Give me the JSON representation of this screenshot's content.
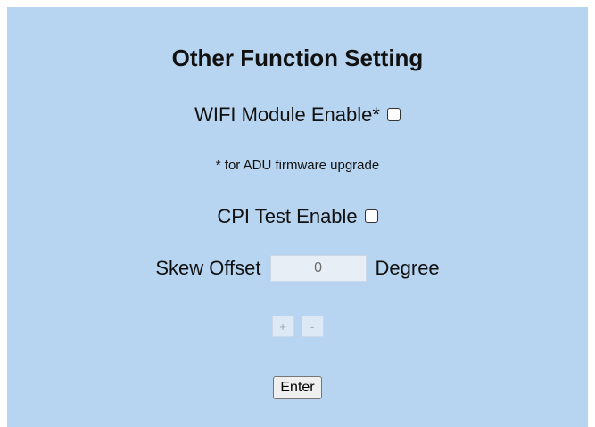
{
  "title": "Other Function Setting",
  "wifi": {
    "label": "WIFI Module Enable*",
    "checked": false,
    "note": "* for ADU firmware upgrade"
  },
  "cpi": {
    "label": "CPI Test Enable",
    "checked": false
  },
  "skew": {
    "label": "Skew Offset",
    "value": "0",
    "unit": "Degree"
  },
  "stepper": {
    "plus": "+",
    "minus": "-"
  },
  "enter_label": "Enter",
  "colors": {
    "panel_bg": "#b7d5f0",
    "input_bg": "#e8eef5"
  }
}
